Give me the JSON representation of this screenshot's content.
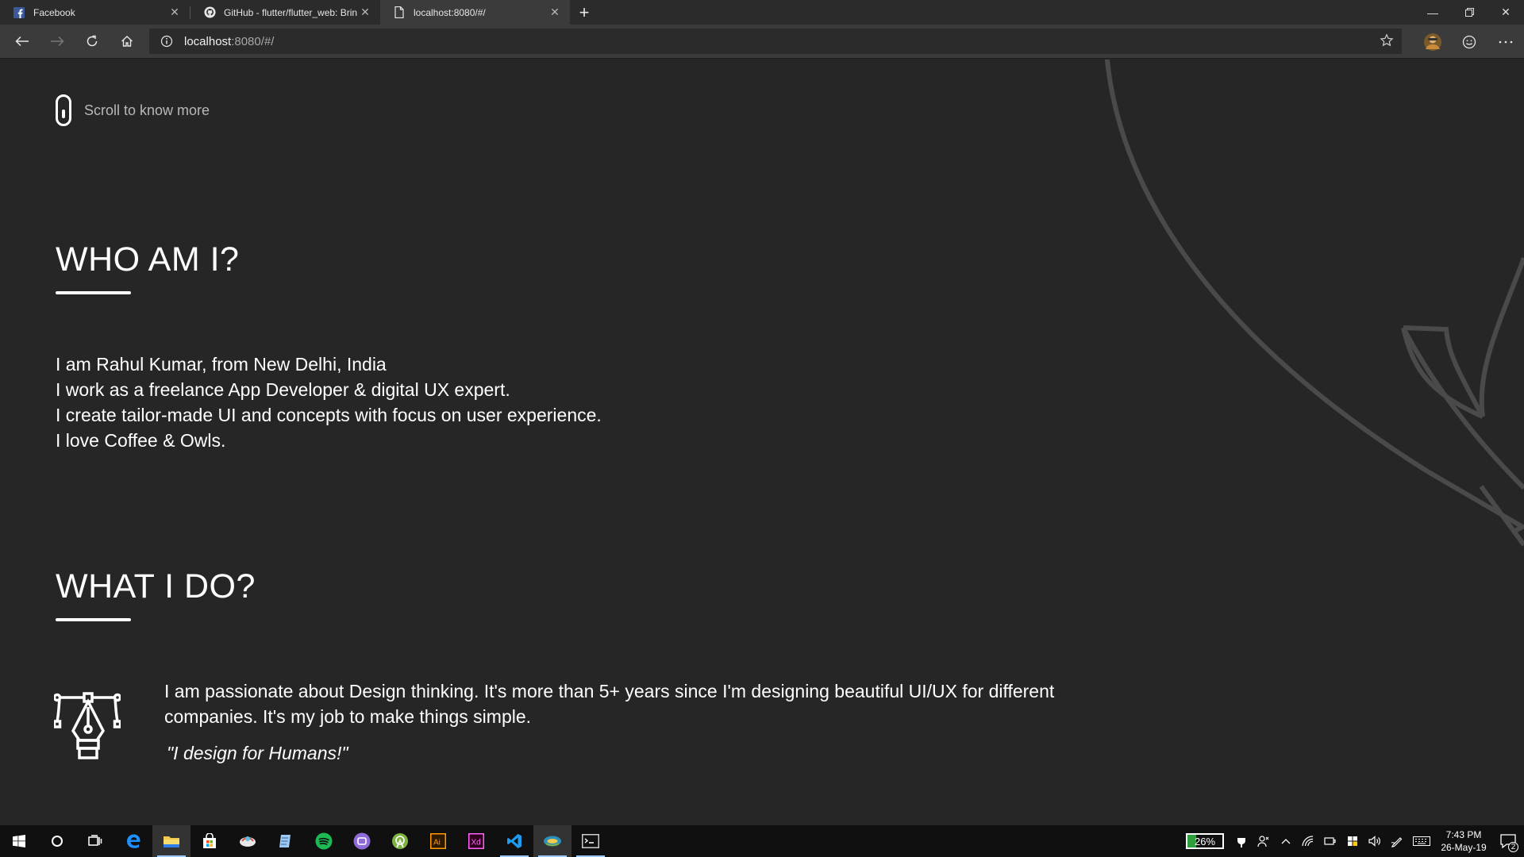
{
  "browser": {
    "tabs": [
      {
        "title": "Facebook",
        "icon": "facebook-icon",
        "active": false
      },
      {
        "title": "GitHub - flutter/flutter_web: Brin",
        "icon": "github-icon",
        "active": false
      },
      {
        "title": "localhost:8080/#/",
        "icon": "page-icon",
        "active": true
      }
    ],
    "url_host": "localhost",
    "url_rest": ":8080/#/"
  },
  "page": {
    "scroll_hint": "Scroll to know more",
    "who_heading": "WHO AM I?",
    "about_lines": [
      "I am Rahul Kumar, from New Delhi, India",
      "I work as a freelance App Developer & digital UX expert.",
      "I create tailor-made UI and concepts with focus on user experience.",
      "I love Coffee & Owls."
    ],
    "what_heading": "WHAT I DO?",
    "what_text": "I am passionate about Design thinking. It's more than 5+ years since I'm designing beautiful UI/UX for different companies. It's my job to make things simple.",
    "quote": "\"I design for Humans!\""
  },
  "taskbar": {
    "battery": "26%",
    "battery_level": 0.26,
    "time": "7:43 PM",
    "date": "26-May-19",
    "notification_count": "2"
  }
}
